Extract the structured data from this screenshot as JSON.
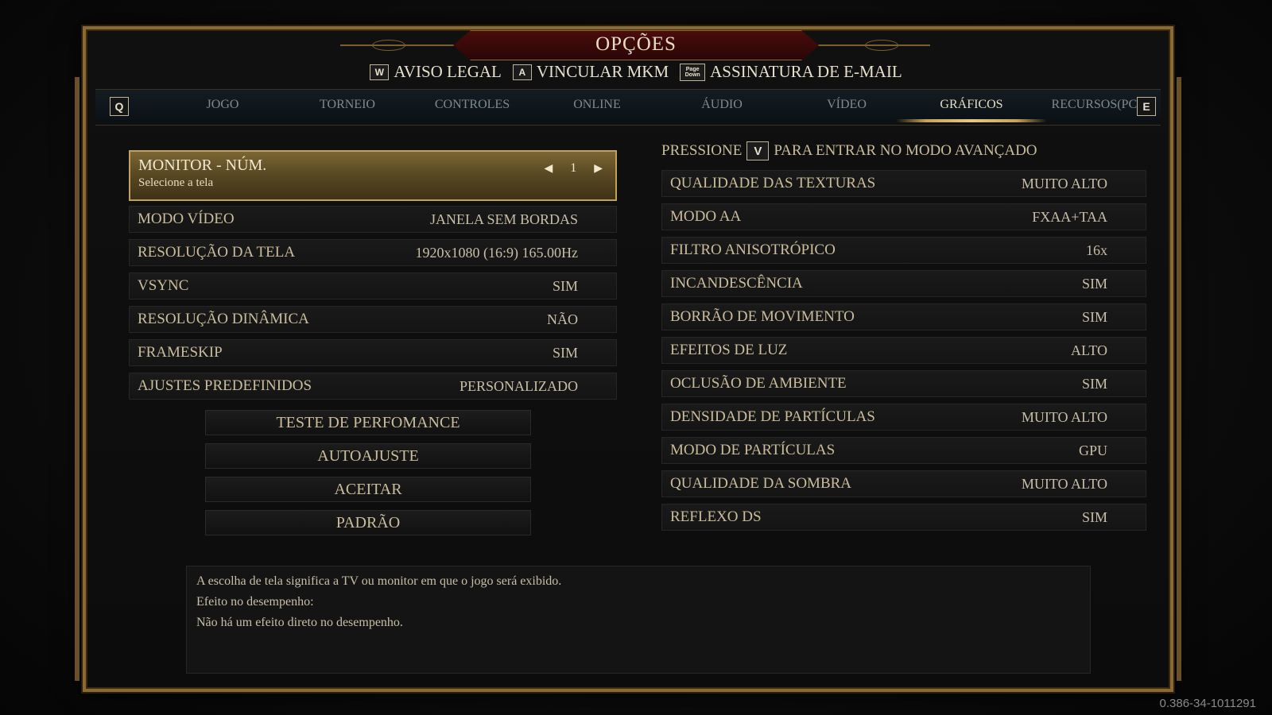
{
  "title": "OPÇÕES",
  "submenu": [
    {
      "key": "W",
      "label": "AVISO LEGAL"
    },
    {
      "key": "A",
      "label": "VINCULAR MKM"
    },
    {
      "key": "Page Down",
      "label": "ASSINATURA DE E-MAIL"
    }
  ],
  "tabs": {
    "prev_key": "Q",
    "next_key": "E",
    "items": [
      "JOGO",
      "TORNEIO",
      "CONTROLES",
      "ONLINE",
      "ÁUDIO",
      "VÍDEO",
      "GRÁFICOS",
      "RECURSOS(PC)"
    ],
    "active": "GRÁFICOS"
  },
  "left": {
    "monitor": {
      "label": "MONITOR - NÚM.",
      "sub": "Selecione a tela",
      "value": "1"
    },
    "rows": [
      {
        "label": "MODO VÍDEO",
        "value": "JANELA SEM BORDAS"
      },
      {
        "label": "RESOLUÇÃO DA TELA",
        "value": "1920x1080 (16:9) 165.00Hz"
      },
      {
        "label": "VSYNC",
        "value": "SIM"
      },
      {
        "label": "RESOLUÇÃO DINÂMICA",
        "value": "NÃO"
      },
      {
        "label": "FRAMESKIP",
        "value": "SIM"
      },
      {
        "label": "AJUSTES PREDEFINIDOS",
        "value": "PERSONALIZADO"
      }
    ],
    "buttons": [
      "TESTE DE PERFOMANCE",
      "AUTOAJUSTE",
      "ACEITAR",
      "PADRÃO"
    ]
  },
  "right": {
    "hint_prefix": "PRESSIONE",
    "hint_key": "V",
    "hint_suffix": "PARA ENTRAR NO MODO AVANÇADO",
    "rows": [
      {
        "label": "QUALIDADE DAS TEXTURAS",
        "value": "MUITO ALTO"
      },
      {
        "label": "MODO AA",
        "value": "FXAA+TAA"
      },
      {
        "label": "FILTRO ANISOTRÓPICO",
        "value": "16x"
      },
      {
        "label": "INCANDESCÊNCIA",
        "value": "SIM"
      },
      {
        "label": "BORRÃO DE MOVIMENTO",
        "value": "SIM"
      },
      {
        "label": "EFEITOS DE LUZ",
        "value": "ALTO"
      },
      {
        "label": "OCLUSÃO DE AMBIENTE",
        "value": "SIM"
      },
      {
        "label": "DENSIDADE DE PARTÍCULAS",
        "value": "MUITO ALTO"
      },
      {
        "label": "MODO DE PARTÍCULAS",
        "value": "GPU"
      },
      {
        "label": "QUALIDADE DA SOMBRA",
        "value": "MUITO ALTO"
      },
      {
        "label": "REFLEXO DS",
        "value": "SIM"
      }
    ]
  },
  "description": [
    "A escolha de tela significa a TV ou monitor em que o jogo será exibido.",
    "Efeito no desempenho:",
    "Não há um efeito direto no desempenho."
  ],
  "version": "0.386-34-1011291"
}
